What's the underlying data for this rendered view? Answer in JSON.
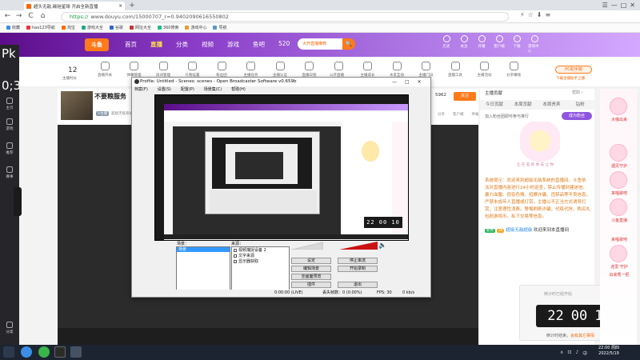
{
  "browser": {
    "tab_title": "超头无敌,碳硅星球 开启全新直播",
    "new_tab": "+",
    "url_secure": "https://",
    "url": "www.douyu.com/15000707_r=0.9402090616550802",
    "nav": {
      "back": "←",
      "forward": "→",
      "reload": "C",
      "home": "⌂"
    },
    "window_controls": [
      "☰",
      "—",
      "□",
      "✕"
    ],
    "bookmarks": [
      "收藏",
      "hao123导航",
      "淘宝",
      "游戏大全",
      "谷歌",
      "网址大全",
      "360搜索",
      "游戏中心",
      "导航"
    ]
  },
  "douyu": {
    "logo": "斗鱼",
    "nav": [
      "首页",
      "直播",
      "分类",
      "视频",
      "游戏",
      "鱼吧",
      "520"
    ],
    "active_nav": "直播",
    "search_placeholder": "大开直播推荐",
    "search_btn": "🔍",
    "header_icons": [
      "历史",
      "关注",
      "开播",
      "客户端",
      "下载",
      "游戏中心"
    ]
  },
  "sidebar": {
    "left_items": [
      "主页",
      "游戏",
      "推荐",
      "赛事",
      "分类"
    ],
    "big_digits": [
      "Pk",
      "0;3",
      "0;3",
      "Pk",
      "0;3",
      "0;3"
    ]
  },
  "categories": {
    "count": "12",
    "count_label": "主播时长",
    "items": [
      "直播开关",
      "弹幕管理",
      "房间管理",
      "礼物设置",
      "粉丝团",
      "主播任务",
      "主播认证",
      "直播日程",
      "公开直播间",
      "主播成长",
      "水友互动",
      "主播门派",
      "直播工具",
      "主播活动",
      "分享赚钱"
    ],
    "pc_btn": "PC助手端",
    "pc_sub": "下载主播助手上播"
  },
  "room": {
    "title": "不要粮服务",
    "badge": "V主播",
    "sub": "超级无敌系统 · 星光同程",
    "follow": "关注",
    "follow_count": "5962",
    "actions": [
      "分享",
      "客户端",
      "举报"
    ]
  },
  "chat": {
    "rank_title": "主播贡献",
    "rank_more": "帮助 ›",
    "tabs": [
      "今日贡献",
      "本周贡献",
      "本周贵宾",
      "钻粉"
    ],
    "fan_line": "加入粉丝团即可参与排行",
    "fan_btn": "成为粉丝",
    "image_caption": "让 在 名 的 你 去 让 你",
    "system_label": "系统提示",
    "system_text": "欢迎来到超级无敌系统的直播间。斗鱼依法对直播内容进行24小时巡查，禁止传播封建迷信、暴力血腥、低俗色情、招嫖诈骗、违禁品等不良信息。严禁未成年人直播或打赏。主播以不正当方式诱导打赏，注意理性消费。警惕刷刷诈骗，代练代抢，购买礼包刷游戏币。私下交易等信息。",
    "welcome_user": "超级无敌超级",
    "welcome_badge1": "新秀",
    "welcome_badge2": "16",
    "welcome_text": "欢迎来到本直播间"
  },
  "clock_widget": {
    "header": "倒计时已经开始",
    "hh": "22",
    "mm": "00",
    "ss": "10",
    "footer_prefix": "倒计时结束",
    "footer_action": "会有其它事情"
  },
  "right_ads": [
    "大咖出来",
    "遇见守护",
    "来唱歌吧",
    "斗鱼直播",
    "来唱歌吧",
    "迎爱·守护",
    "出来秀一把",
    "来加入守护"
  ],
  "obs": {
    "title": "Profile: Untitled - Scenes: scenes - Open Broadcaster Software v0.659b",
    "window_controls": [
      "—",
      "□",
      "✕"
    ],
    "menu": [
      "档案(F)",
      "设置(S)",
      "配置(P)",
      "场景集(C)",
      "帮助(H)"
    ],
    "scenes_label": "场景：",
    "sources_label": "来源：",
    "scene_item": "场景",
    "sources": [
      "视频捕捉设备 2",
      "文字来源",
      "显示器获取"
    ],
    "buttons": [
      "设定",
      "停止串流",
      "编辑场景",
      "开始录制",
      "全画面预览",
      "插件",
      "退出"
    ],
    "status": [
      "0:00:00  (LIVE)",
      "丢失帧数：0  (0.00%)",
      "FPS: 30",
      "0 kb/s"
    ],
    "nested_clock": "22 00 10"
  },
  "taskbar": {
    "time": "22:00 周四",
    "date": "2022/5/19",
    "tray": [
      "∧",
      "⊡",
      "♪",
      "中"
    ]
  },
  "colors": {
    "brand": "#ff7a1a",
    "header_purple": "#5b0d8a",
    "obs_selected": "#3399ff",
    "meter_red": "#cc1111",
    "taskbar": "#1c2431"
  }
}
